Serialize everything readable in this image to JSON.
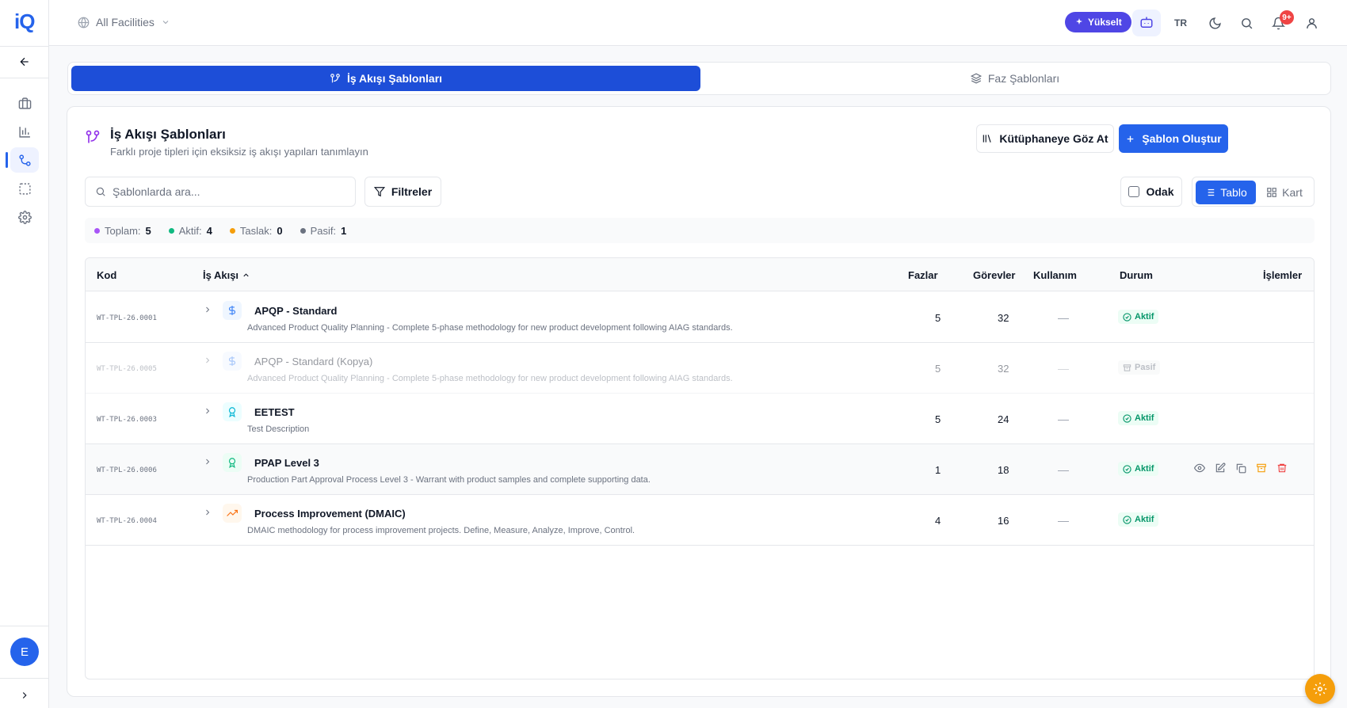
{
  "app": {
    "logo": "iQ"
  },
  "header": {
    "facility_label": "All Facilities",
    "upgrade_label": "Yükselt",
    "language": "TR",
    "notif_count": "9+"
  },
  "sidebar": {
    "items": [
      {
        "name": "back",
        "icon": "arrow-left-icon"
      },
      {
        "name": "briefcase",
        "icon": "briefcase-icon"
      },
      {
        "name": "chart",
        "icon": "bar-chart-icon"
      },
      {
        "name": "workflow",
        "icon": "workflow-icon",
        "active": true
      },
      {
        "name": "select",
        "icon": "dashed-square-icon"
      },
      {
        "name": "settings",
        "icon": "gear-icon"
      }
    ],
    "avatar_initial": "E"
  },
  "tabs": {
    "workflow_templates": "İş Akışı Şablonları",
    "phase_templates": "Faz Şablonları"
  },
  "card": {
    "title": "İş Akışı Şablonları",
    "subtitle": "Farklı proje tipleri için eksiksiz iş akışı yapıları tanımlayın",
    "browse_library": "Kütüphaneye Göz At",
    "create_template": "Şablon Oluştur",
    "search_placeholder": "Şablonlarda ara...",
    "filters": "Filtreler",
    "focus": "Odak",
    "view_table": "Tablo",
    "view_card": "Kart"
  },
  "stats": {
    "total_label": "Toplam:",
    "total": "5",
    "active_label": "Aktif:",
    "active": "4",
    "draft_label": "Taslak:",
    "draft": "0",
    "passive_label": "Pasif:",
    "passive": "1",
    "colors": {
      "total": "#a855f7",
      "active": "#10b981",
      "draft": "#f59e0b",
      "passive": "#6b7280"
    }
  },
  "table": {
    "headers": {
      "code": "Kod",
      "workflow": "İş Akışı",
      "phases": "Fazlar",
      "tasks": "Görevler",
      "usage": "Kullanım",
      "status": "Durum",
      "actions": "İşlemler"
    },
    "rows": [
      {
        "code": "WT-TPL-26.0001",
        "name": "APQP - Standard",
        "desc": "Advanced Product Quality Planning - Complete 5-phase methodology for new product development following AIAG standards.",
        "phases": "5",
        "tasks": "32",
        "usage": "—",
        "status": "Aktif",
        "icon": "dollar-icon"
      },
      {
        "code": "WT-TPL-26.0005",
        "name": "APQP - Standard (Kopya)",
        "desc": "Advanced Product Quality Planning - Complete 5-phase methodology for new product development following AIAG standards.",
        "phases": "5",
        "tasks": "32",
        "usage": "—",
        "status": "Pasif",
        "icon": "dollar-icon"
      },
      {
        "code": "WT-TPL-26.0003",
        "name": "EETEST",
        "desc": "Test Description",
        "phases": "5",
        "tasks": "24",
        "usage": "—",
        "status": "Aktif",
        "icon": "award-icon"
      },
      {
        "code": "WT-TPL-26.0006",
        "name": "PPAP Level 3",
        "desc": "Production Part Approval Process Level 3 - Warrant with product samples and complete supporting data.",
        "phases": "1",
        "tasks": "18",
        "usage": "—",
        "status": "Aktif",
        "icon": "award-icon"
      },
      {
        "code": "WT-TPL-26.0004",
        "name": "Process Improvement (DMAIC)",
        "desc": "DMAIC methodology for process improvement projects. Define, Measure, Analyze, Improve, Control.",
        "phases": "4",
        "tasks": "16",
        "usage": "—",
        "status": "Aktif",
        "icon": "trending-up-icon"
      }
    ]
  }
}
